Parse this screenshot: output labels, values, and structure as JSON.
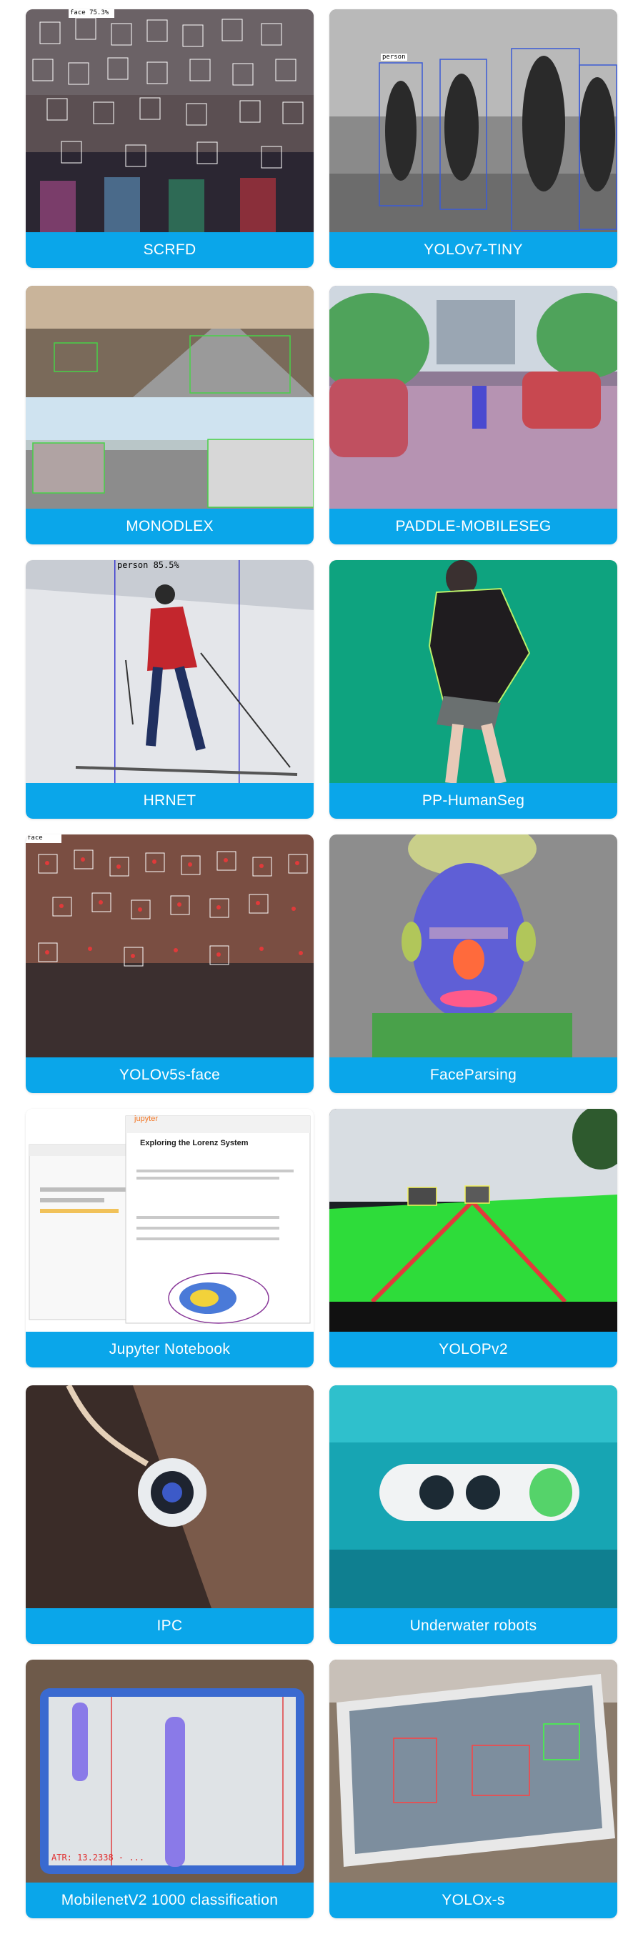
{
  "cards": [
    {
      "label": "SCRFD",
      "overlay": "face 75.3%"
    },
    {
      "label": "YOLOv7-TINY",
      "overlay": "person"
    },
    {
      "label": "MONODLEX"
    },
    {
      "label": "PADDLE-MOBILESEG"
    },
    {
      "label": "HRNET",
      "overlay": "person  85.5%"
    },
    {
      "label": "PP-HumanSeg"
    },
    {
      "label": "YOLOv5s-face",
      "overlay": "face"
    },
    {
      "label": "FaceParsing"
    },
    {
      "label": "Jupyter Notebook",
      "overlay": "jupyter",
      "doc_title": "Exploring the Lorenz System"
    },
    {
      "label": "YOLOPv2"
    },
    {
      "label": "IPC"
    },
    {
      "label": "Underwater robots"
    },
    {
      "label": "MobilenetV2 1000 classification",
      "overlay": "ATR: 13.2338 - ..."
    },
    {
      "label": "YOLOx-s"
    }
  ],
  "colors": {
    "label_bg": "#0aa6ea",
    "label_text": "#ffffff"
  }
}
